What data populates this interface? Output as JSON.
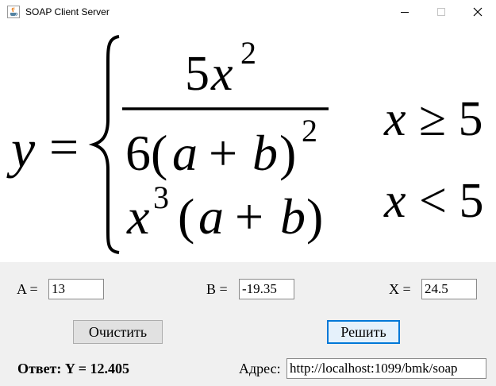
{
  "window": {
    "title": "SOAP Client Server",
    "app_icon": "java-cup-icon"
  },
  "formula": {
    "lhs": "y",
    "equals": "=",
    "case1": {
      "numerator": "5x²",
      "denominator": "6(a + b)²",
      "condition": "x ≥ 5"
    },
    "case2": {
      "expression": "x³(a + b)",
      "condition": "x < 5"
    }
  },
  "inputs": {
    "a": {
      "label": "A =",
      "value": "13"
    },
    "b": {
      "label": "B =",
      "value": "-19.35"
    },
    "x": {
      "label": "X =",
      "value": "24.5"
    }
  },
  "buttons": {
    "clear_label": "Очистить",
    "solve_label": "Решить"
  },
  "answer": "Ответ: Y = 12.405",
  "address": {
    "label": "Адрес:",
    "value": "http://localhost:1099/bmk/soap"
  }
}
